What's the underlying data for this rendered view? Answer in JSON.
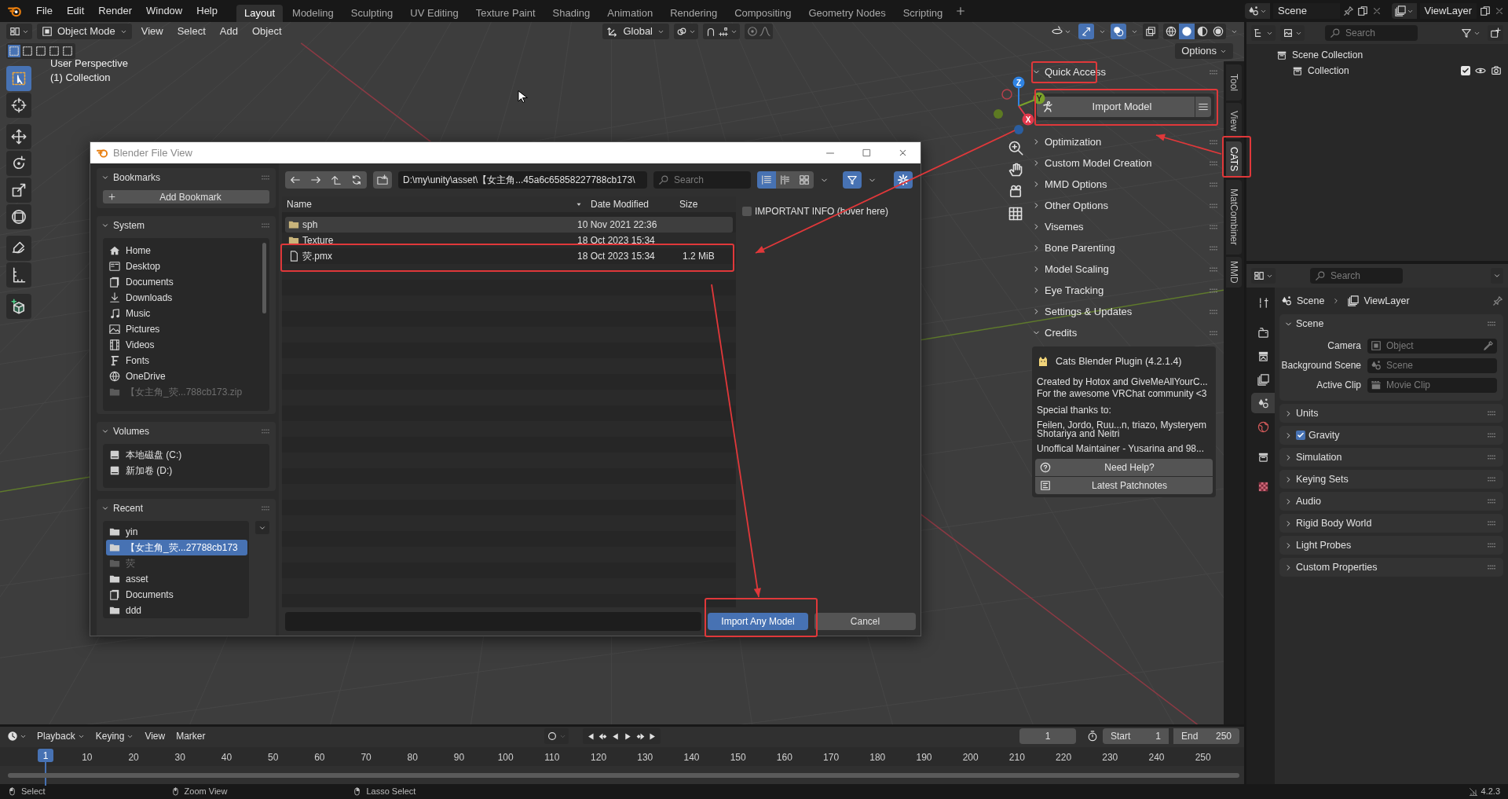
{
  "top_menu": [
    "File",
    "Edit",
    "Render",
    "Window",
    "Help"
  ],
  "workspace_tabs": [
    {
      "label": "Layout",
      "selected": true
    },
    {
      "label": "Modeling",
      "selected": false
    },
    {
      "label": "Sculpting",
      "selected": false
    },
    {
      "label": "UV Editing",
      "selected": false
    },
    {
      "label": "Texture Paint",
      "selected": false
    },
    {
      "label": "Shading",
      "selected": false
    },
    {
      "label": "Animation",
      "selected": false
    },
    {
      "label": "Rendering",
      "selected": false
    },
    {
      "label": "Compositing",
      "selected": false
    },
    {
      "label": "Geometry Nodes",
      "selected": false
    },
    {
      "label": "Scripting",
      "selected": false
    }
  ],
  "scene": "Scene",
  "view_layer": "ViewLayer",
  "viewport": {
    "mode": "Object Mode",
    "menus": [
      "View",
      "Select",
      "Add",
      "Object"
    ],
    "orientation": "Global",
    "options": "Options",
    "info": [
      "User Perspective",
      "(1) Collection"
    ],
    "tools": [
      {
        "kind": "select-box",
        "selected": true
      },
      {
        "kind": "cursor",
        "selected": false
      },
      {
        "kind": "move",
        "selected": false
      },
      {
        "kind": "rotate",
        "selected": false
      },
      {
        "kind": "scale",
        "selected": false
      },
      {
        "kind": "transform",
        "selected": false
      },
      {
        "kind": "annotate",
        "selected": false
      },
      {
        "kind": "measure",
        "selected": false
      },
      {
        "kind": "add-cube",
        "selected": false
      }
    ],
    "gizmo": {
      "x": "X",
      "y": "Y",
      "z": "Z"
    },
    "shading_modes": [
      {
        "kind": "wireframe",
        "selected": false
      },
      {
        "kind": "solid",
        "selected": true
      },
      {
        "kind": "material",
        "selected": false
      },
      {
        "kind": "rendered",
        "selected": false
      }
    ]
  },
  "sidebar": {
    "tabs": [
      {
        "label": "Tool",
        "selected": false
      },
      {
        "label": "View",
        "selected": false
      },
      {
        "label": "CATS",
        "selected": true
      },
      {
        "label": "MatCombiner",
        "selected": false
      },
      {
        "label": "MMD",
        "selected": false
      }
    ],
    "sections": [
      {
        "label": "Quick Access",
        "expanded": true,
        "kind": "quick"
      },
      {
        "label": "Optimization",
        "expanded": false,
        "kind": "plain"
      },
      {
        "label": "Custom Model Creation",
        "expanded": false,
        "kind": "plain"
      },
      {
        "label": "MMD Options",
        "expanded": false,
        "kind": "plain"
      },
      {
        "label": "Other Options",
        "expanded": false,
        "kind": "plain"
      },
      {
        "label": "Visemes",
        "expanded": false,
        "kind": "plain"
      },
      {
        "label": "Bone Parenting",
        "expanded": false,
        "kind": "plain"
      },
      {
        "label": "Model Scaling",
        "expanded": false,
        "kind": "plain"
      },
      {
        "label": "Eye Tracking",
        "expanded": false,
        "kind": "plain"
      },
      {
        "label": "Settings & Updates",
        "expanded": false,
        "kind": "plain"
      },
      {
        "label": "Credits",
        "expanded": true,
        "kind": "credits"
      }
    ],
    "import_button": "Import Model",
    "credits": {
      "title": "Cats Blender Plugin (4.2.1.4)",
      "paragraphs": [
        [
          "Created by Hotox and GiveMeAllYourC...",
          "For the awesome VRChat community <3"
        ],
        [
          "Special thanks to:"
        ],
        [
          "Feilen, Jordo, Ruu...n, triazo, Mysteryem",
          "Shotariya and Neitri"
        ],
        [
          "Unoffical Maintainer - Yusarina and 98..."
        ]
      ],
      "buttons": [
        {
          "label": "Need Help?",
          "kind": "help"
        },
        {
          "label": "Latest Patchnotes",
          "kind": "notes"
        }
      ]
    }
  },
  "timeline": {
    "auto_keying": false,
    "menus": [
      "Playback",
      "Keying",
      "View",
      "Marker"
    ],
    "current_frame": "1",
    "start_label": "Start",
    "start": "1",
    "end_label": "End",
    "end": "250",
    "playhead": "1",
    "ruler": [
      "10",
      "20",
      "30",
      "40",
      "50",
      "60",
      "70",
      "80",
      "90",
      "100",
      "110",
      "120",
      "130",
      "140",
      "150",
      "160",
      "170",
      "180",
      "190",
      "200",
      "210",
      "220",
      "230",
      "240",
      "250"
    ]
  },
  "status_bar": {
    "hints": [
      {
        "kind": "left",
        "label": "Select"
      },
      {
        "kind": "middle",
        "label": "Zoom View"
      },
      {
        "kind": "right",
        "label": "Lasso Select"
      }
    ],
    "version": "4.2.3"
  },
  "outliner": {
    "search_placeholder": "Search",
    "root": {
      "label": "Scene Collection",
      "children": [
        {
          "label": "Collection",
          "checked": true
        }
      ]
    }
  },
  "properties": {
    "search_placeholder": "Search",
    "breadcrumb": [
      "Scene",
      "ViewLayer"
    ],
    "tabs": [
      {
        "kind": "tool",
        "selected": false
      },
      {
        "kind": "render",
        "selected": false
      },
      {
        "kind": "output",
        "selected": false
      },
      {
        "kind": "view-layer",
        "selected": false
      },
      {
        "kind": "scene",
        "selected": true
      },
      {
        "kind": "world",
        "selected": false
      },
      {
        "kind": "collection",
        "selected": false
      },
      {
        "kind": "texture",
        "selected": false
      }
    ],
    "panels": [
      {
        "label": "Scene",
        "expanded": true,
        "kind": "fields",
        "fields": [
          {
            "label": "Camera",
            "placeholder": "Object",
            "kind": "object"
          },
          {
            "label": "Background Scene",
            "placeholder": "Scene",
            "kind": "scene"
          },
          {
            "label": "Active Clip",
            "placeholder": "Movie Clip",
            "kind": "clip"
          }
        ]
      },
      {
        "label": "Units",
        "expanded": false,
        "kind": "plain"
      },
      {
        "label": "Gravity",
        "expanded": false,
        "kind": "checkbox",
        "checked": true
      },
      {
        "label": "Simulation",
        "expanded": false,
        "kind": "plain"
      },
      {
        "label": "Keying Sets",
        "expanded": false,
        "kind": "plain"
      },
      {
        "label": "Audio",
        "expanded": false,
        "kind": "plain"
      },
      {
        "label": "Rigid Body World",
        "expanded": false,
        "kind": "plain"
      },
      {
        "label": "Light Probes",
        "expanded": false,
        "kind": "plain"
      },
      {
        "label": "Custom Properties",
        "expanded": false,
        "kind": "plain"
      }
    ]
  },
  "file_dialog": {
    "title": "Blender File View",
    "bookmarks": {
      "label": "Bookmarks",
      "expanded": true,
      "button": "Add Bookmark"
    },
    "system": {
      "label": "System",
      "expanded": true,
      "items": [
        {
          "label": "Home",
          "kind": "home",
          "disabled": false
        },
        {
          "label": "Desktop",
          "kind": "desktop",
          "disabled": false
        },
        {
          "label": "Documents",
          "kind": "documents",
          "disabled": false
        },
        {
          "label": "Downloads",
          "kind": "downloads",
          "disabled": false
        },
        {
          "label": "Music",
          "kind": "music",
          "disabled": false
        },
        {
          "label": "Pictures",
          "kind": "pictures",
          "disabled": false
        },
        {
          "label": "Videos",
          "kind": "videos",
          "disabled": false
        },
        {
          "label": "Fonts",
          "kind": "fonts",
          "disabled": false
        },
        {
          "label": "OneDrive",
          "kind": "globe",
          "disabled": false
        },
        {
          "label": "【女主角_荧...788cb173.zip",
          "kind": "folder",
          "disabled": true
        }
      ]
    },
    "volumes": {
      "label": "Volumes",
      "expanded": true,
      "items": [
        {
          "label": "本地磁盘 (C:)",
          "kind": "drive",
          "disabled": false
        },
        {
          "label": "新加卷 (D:)",
          "kind": "drive",
          "disabled": false
        }
      ]
    },
    "recent": {
      "label": "Recent",
      "expanded": true,
      "items": [
        {
          "label": "yin",
          "kind": "folder",
          "disabled": false,
          "selected": false
        },
        {
          "label": "【女主角_荧...27788cb173",
          "kind": "folder",
          "disabled": false,
          "selected": true
        },
        {
          "label": "荧",
          "kind": "folder",
          "disabled": true,
          "selected": false
        },
        {
          "label": "asset",
          "kind": "folder",
          "disabled": false,
          "selected": false
        },
        {
          "label": "Documents",
          "kind": "documents",
          "disabled": false,
          "selected": false
        },
        {
          "label": "ddd",
          "kind": "folder",
          "disabled": false,
          "selected": false
        }
      ]
    },
    "path": "D:\\my\\unity\\asset\\【女主角...45a6c65858227788cb173\\",
    "search_placeholder": "Search",
    "view_modes": [
      {
        "kind": "list",
        "selected": true
      },
      {
        "kind": "columns",
        "selected": false
      },
      {
        "kind": "grid",
        "selected": false
      }
    ],
    "columns": [
      "Name",
      "Date Modified",
      "Size"
    ],
    "files": [
      {
        "name": "sph",
        "kind": "folder",
        "date": "10 Nov 2021 22:36",
        "selected": true
      },
      {
        "name": "Texture",
        "kind": "folder",
        "date": "18 Oct 2023 15:34",
        "selected": false
      },
      {
        "name": "荧.pmx",
        "kind": "file",
        "date": "18 Oct 2023 15:34",
        "size": "1.2 MiB",
        "selected": false
      }
    ],
    "option": {
      "label": "IMPORTANT INFO (hover here)",
      "checked": false
    },
    "import_button": "Import Any Model",
    "cancel_button": "Cancel"
  }
}
